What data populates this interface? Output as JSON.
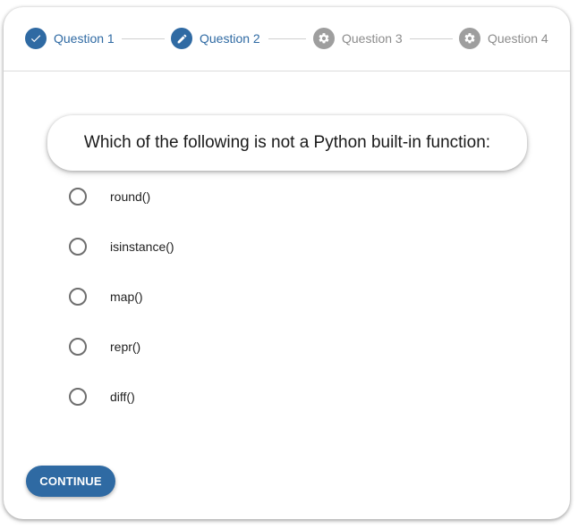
{
  "stepper": {
    "steps": [
      {
        "label": "Question 1",
        "icon": "check-icon",
        "state": "completed",
        "color": "#2f6aa3"
      },
      {
        "label": "Question 2",
        "icon": "pencil-icon",
        "state": "current",
        "color": "#2f6aa3"
      },
      {
        "label": "Question 3",
        "icon": "gear-icon",
        "state": "pending",
        "color": "#9e9e9e"
      },
      {
        "label": "Question 4",
        "icon": "gear-icon",
        "state": "pending",
        "color": "#9e9e9e"
      }
    ]
  },
  "question": {
    "text": "Which of the following is not a Python built-in function:",
    "options": [
      {
        "label": "round()",
        "selected": false
      },
      {
        "label": "isinstance()",
        "selected": false
      },
      {
        "label": "map()",
        "selected": false
      },
      {
        "label": "repr()",
        "selected": false
      },
      {
        "label": "diff()",
        "selected": false
      }
    ]
  },
  "actions": {
    "continue_label": "CONTINUE"
  },
  "colors": {
    "accent": "#2f6aa3",
    "inactive": "#9e9e9e"
  }
}
